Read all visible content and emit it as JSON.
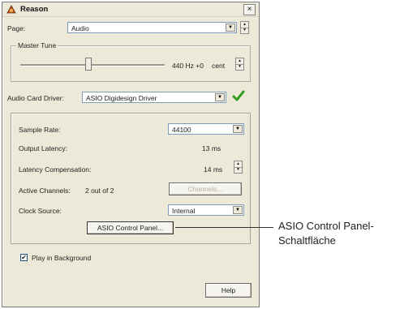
{
  "window": {
    "title": "Reason",
    "close_glyph": "×"
  },
  "page": {
    "label": "Page:",
    "selected": "Audio"
  },
  "master_tune": {
    "legend": "Master Tune",
    "value": "440 Hz +0",
    "unit": "cent",
    "slider_position": 0.45
  },
  "audio_card": {
    "label": "Audio Card Driver:",
    "selected": "ASIO Digidesign Driver",
    "status_icon": "checkmark-icon",
    "status_color": "#2f9a1c"
  },
  "settings": {
    "sample_rate": {
      "label": "Sample Rate:",
      "value": "44100"
    },
    "output_latency": {
      "label": "Output Latency:",
      "value": "13 ms"
    },
    "latency_comp": {
      "label": "Latency Compensation:",
      "value": "14 ms"
    },
    "active_channels": {
      "label": "Active Channels:",
      "value": "2 out of 2",
      "button": "Channels..."
    },
    "clock_source": {
      "label": "Clock Source:",
      "selected": "Internal"
    },
    "asio_button": "ASIO Control Panel..."
  },
  "play_in_background": {
    "label": "Play in Background",
    "checked": true,
    "check_glyph": "✔"
  },
  "help_button": "Help",
  "callout": {
    "line1": "ASIO Control Panel-",
    "line2": "Schaltfläche"
  }
}
